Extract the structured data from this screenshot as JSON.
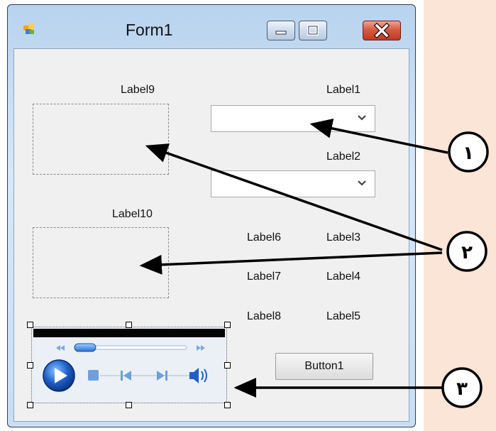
{
  "window": {
    "title": "Form1"
  },
  "labels": {
    "label1": "Label1",
    "label2": "Label2",
    "label3": "Label3",
    "label4": "Label4",
    "label5": "Label5",
    "label6": "Label6",
    "label7": "Label7",
    "label8": "Label8",
    "label9": "Label9",
    "label10": "Label10"
  },
  "button": {
    "label": "Button1"
  },
  "annotations": {
    "badge1": "١",
    "badge2": "٢",
    "badge3": "٣"
  },
  "colors": {
    "annotation_bg": "#fbe5d6",
    "close_red": "#c13a22",
    "player_blue": "#2a6fd6"
  },
  "media_player": {
    "controls": [
      "rewind-icon",
      "fast-forward-icon",
      "play-icon",
      "stop-icon",
      "previous-icon",
      "next-icon",
      "volume-icon"
    ]
  }
}
